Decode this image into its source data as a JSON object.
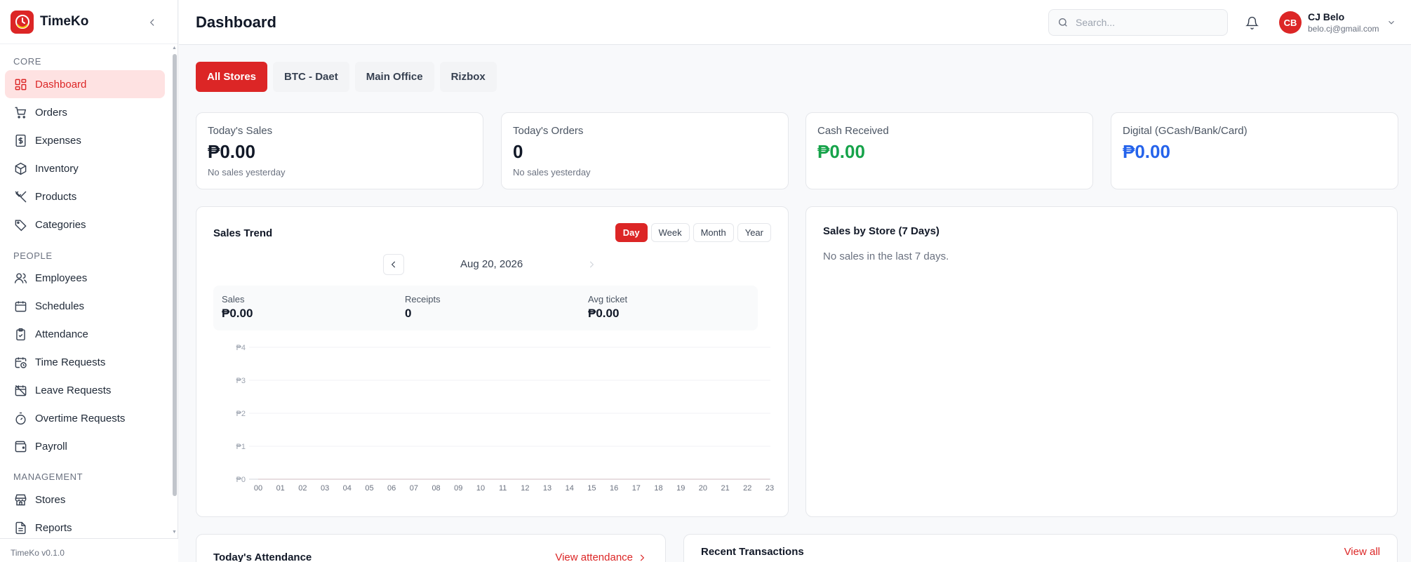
{
  "app": {
    "name": "TimeKo",
    "version": "TimeKo v0.1.0"
  },
  "sidebar": {
    "sections": [
      {
        "label": "CORE",
        "items": [
          {
            "label": "Dashboard",
            "icon": "dashboard-icon",
            "active": true
          },
          {
            "label": "Orders",
            "icon": "cart-icon"
          },
          {
            "label": "Expenses",
            "icon": "dollar-receipt-icon"
          },
          {
            "label": "Inventory",
            "icon": "box-icon"
          },
          {
            "label": "Products",
            "icon": "utensils-icon"
          },
          {
            "label": "Categories",
            "icon": "tags-icon"
          }
        ]
      },
      {
        "label": "PEOPLE",
        "items": [
          {
            "label": "Employees",
            "icon": "users-icon"
          },
          {
            "label": "Schedules",
            "icon": "calendar-icon"
          },
          {
            "label": "Attendance",
            "icon": "clipboard-check-icon"
          },
          {
            "label": "Time Requests",
            "icon": "calendar-clock-icon"
          },
          {
            "label": "Leave Requests",
            "icon": "calendar-off-icon"
          },
          {
            "label": "Overtime Requests",
            "icon": "timer-icon"
          },
          {
            "label": "Payroll",
            "icon": "wallet-icon"
          }
        ]
      },
      {
        "label": "MANAGEMENT",
        "items": [
          {
            "label": "Stores",
            "icon": "store-icon"
          },
          {
            "label": "Reports",
            "icon": "file-icon"
          }
        ]
      }
    ]
  },
  "header": {
    "title": "Dashboard",
    "search_placeholder": "Search...",
    "user": {
      "initials": "CB",
      "name": "CJ Belo",
      "email": "belo.cj@gmail.com"
    }
  },
  "store_tabs": [
    {
      "label": "All Stores",
      "active": true
    },
    {
      "label": "BTC - Daet"
    },
    {
      "label": "Main Office"
    },
    {
      "label": "Rizbox"
    }
  ],
  "stats": [
    {
      "label": "Today's Sales",
      "value": "₱0.00",
      "sub": "No sales yesterday",
      "color": "#111827"
    },
    {
      "label": "Today's Orders",
      "value": "0",
      "sub": "No sales yesterday",
      "color": "#111827"
    },
    {
      "label": "Cash Received",
      "value": "₱0.00",
      "sub": "",
      "color": "#16a34a"
    },
    {
      "label": "Digital (GCash/Bank/Card)",
      "value": "₱0.00",
      "sub": "",
      "color": "#2563eb"
    }
  ],
  "sales_trend": {
    "title": "Sales Trend",
    "ranges": [
      {
        "label": "Day",
        "active": true
      },
      {
        "label": "Week"
      },
      {
        "label": "Month"
      },
      {
        "label": "Year"
      }
    ],
    "date": "Aug 20, 2026",
    "kpis": [
      {
        "label": "Sales",
        "value": "₱0.00"
      },
      {
        "label": "Receipts",
        "value": "0"
      },
      {
        "label": "Avg ticket",
        "value": "₱0.00"
      }
    ]
  },
  "chart_data": {
    "type": "line",
    "title": "",
    "x": [
      "00",
      "01",
      "02",
      "03",
      "04",
      "05",
      "06",
      "07",
      "08",
      "09",
      "10",
      "11",
      "12",
      "13",
      "14",
      "15",
      "16",
      "17",
      "18",
      "19",
      "20",
      "21",
      "22",
      "23"
    ],
    "series": [
      {
        "values": [
          0,
          0,
          0,
          0,
          0,
          0,
          0,
          0,
          0,
          0,
          0,
          0,
          0,
          0,
          0,
          0,
          0,
          0,
          0,
          0,
          0,
          0,
          0,
          0
        ]
      }
    ],
    "yticks": [
      "₱0",
      "₱1",
      "₱2",
      "₱3",
      "₱4"
    ],
    "ylim": [
      0,
      4
    ],
    "grid": true
  },
  "sales_by_store": {
    "title": "Sales by Store (7 Days)",
    "empty": "No sales in the last 7 days."
  },
  "attendance": {
    "title": "Today's Attendance",
    "link": "View attendance"
  },
  "transactions": {
    "title": "Recent Transactions",
    "link": "View all"
  },
  "colors": {
    "accent": "#dc2626",
    "accent_soft": "#fee2e2",
    "green": "#16a34a",
    "blue": "#2563eb"
  }
}
